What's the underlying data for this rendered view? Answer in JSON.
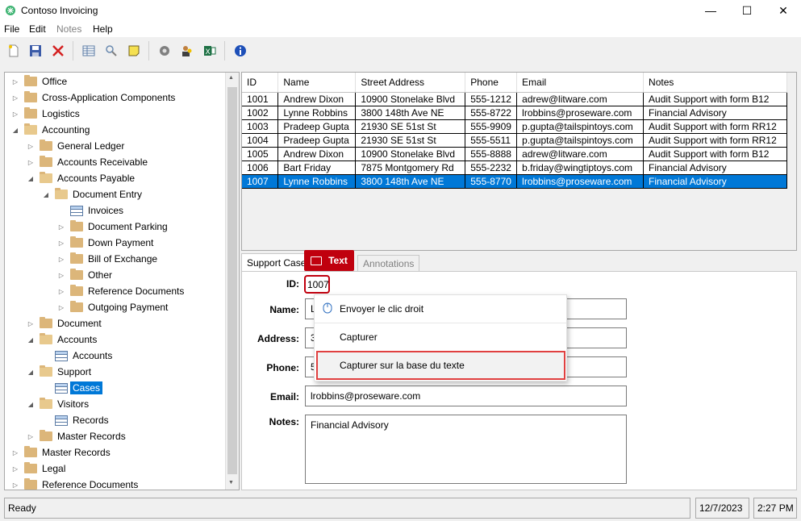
{
  "window": {
    "title": "Contoso Invoicing",
    "minimize": "—",
    "maximize": "☐",
    "close": "✕"
  },
  "menu": {
    "file": "File",
    "edit": "Edit",
    "notes": "Notes",
    "help": "Help"
  },
  "toolbar": {
    "icons": [
      "new-icon",
      "save-icon",
      "delete-icon",
      "table-icon",
      "search-icon",
      "note-icon",
      "settings-icon",
      "users-icon",
      "excel-icon",
      "info-icon"
    ]
  },
  "tree": {
    "office": "Office",
    "cross_app": "Cross-Application Components",
    "logistics": "Logistics",
    "accounting": "Accounting",
    "general_ledger": "General Ledger",
    "accounts_receivable": "Accounts Receivable",
    "accounts_payable": "Accounts Payable",
    "document_entry": "Document Entry",
    "invoices": "Invoices",
    "document_parking": "Document Parking",
    "down_payment": "Down Payment",
    "bill_of_exchange": "Bill of Exchange",
    "other": "Other",
    "reference_documents_sub": "Reference Documents",
    "outgoing_payment": "Outgoing Payment",
    "document": "Document",
    "accounts": "Accounts",
    "accounts_grid": "Accounts",
    "support": "Support",
    "cases": "Cases",
    "visitors": "Visitors",
    "records": "Records",
    "master_records_sub": "Master Records",
    "master_records": "Master Records",
    "legal": "Legal",
    "reference_documents": "Reference Documents"
  },
  "grid": {
    "headers": {
      "id": "ID",
      "name": "Name",
      "street": "Street Address",
      "phone": "Phone",
      "email": "Email",
      "notes": "Notes"
    },
    "rows": [
      {
        "id": "1001",
        "name": "Andrew Dixon",
        "street": "10900 Stonelake Blvd",
        "phone": "555-1212",
        "email": "adrew@litware.com",
        "notes": "Audit Support with form B12"
      },
      {
        "id": "1002",
        "name": "Lynne Robbins",
        "street": "3800 148th Ave NE",
        "phone": "555-8722",
        "email": "lrobbins@proseware.com",
        "notes": "Financial Advisory"
      },
      {
        "id": "1003",
        "name": "Pradeep Gupta",
        "street": "21930 SE 51st St",
        "phone": "555-9909",
        "email": "p.gupta@tailspintoys.com",
        "notes": "Audit Support with form RR12"
      },
      {
        "id": "1004",
        "name": "Pradeep Gupta",
        "street": "21930 SE 51st St",
        "phone": "555-5511",
        "email": "p.gupta@tailspintoys.com",
        "notes": "Audit Support with form RR12"
      },
      {
        "id": "1005",
        "name": "Andrew Dixon",
        "street": "10900 Stonelake Blvd",
        "phone": "555-8888",
        "email": "adrew@litware.com",
        "notes": "Audit Support with form B12"
      },
      {
        "id": "1006",
        "name": "Bart Friday",
        "street": "7875 Montgomery Rd",
        "phone": "555-2232",
        "email": "b.friday@wingtiptoys.com",
        "notes": "Financial Advisory"
      },
      {
        "id": "1007",
        "name": "Lynne Robbins",
        "street": "3800 148th Ave NE",
        "phone": "555-8770",
        "email": "lrobbins@proseware.com",
        "notes": "Financial Advisory"
      }
    ]
  },
  "tabs": {
    "support_case": "Support Case",
    "annotations": "Annotations"
  },
  "form": {
    "id_label": "ID:",
    "id_value": "1007",
    "name_label": "Name:",
    "name_value": "L",
    "address_label": "Address:",
    "address_value": "3",
    "phone_label": "Phone:",
    "phone_value": "5",
    "email_label": "Email:",
    "email_value": "lrobbins@proseware.com",
    "notes_label": "Notes:",
    "notes_value": "Financial Advisory"
  },
  "overlay": {
    "badge_label": "Text"
  },
  "context_menu": {
    "right_click": "Envoyer le clic droit",
    "capture": "Capturer",
    "capture_text": "Capturer sur la base du texte"
  },
  "status": {
    "ready": "Ready",
    "date": "12/7/2023",
    "time": "2:27 PM"
  }
}
